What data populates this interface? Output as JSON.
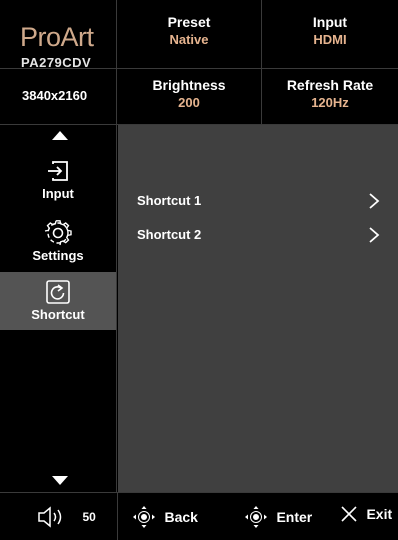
{
  "brand": {
    "logo": "ProArt",
    "model": "PA279CDV",
    "resolution": "3840x2160"
  },
  "status": {
    "preset": {
      "label": "Preset",
      "value": "Native"
    },
    "input": {
      "label": "Input",
      "value": "HDMI"
    },
    "brightness": {
      "label": "Brightness",
      "value": "200"
    },
    "refresh_rate": {
      "label": "Refresh Rate",
      "value": "120Hz"
    }
  },
  "sidebar": {
    "items": [
      {
        "label": "Input",
        "icon": "input-icon",
        "active": false
      },
      {
        "label": "Settings",
        "icon": "gear-icon",
        "active": false
      },
      {
        "label": "Shortcut",
        "icon": "shortcut-icon",
        "active": true
      }
    ]
  },
  "main": {
    "rows": [
      {
        "label": "Shortcut 1",
        "icon": "chevron-right-icon"
      },
      {
        "label": "Shortcut 2",
        "icon": "chevron-right-icon"
      }
    ]
  },
  "footer": {
    "volume": "50",
    "back": "Back",
    "enter": "Enter",
    "exit": "Exit"
  },
  "colors": {
    "accent": "#e6b48f",
    "logo": "#cfa98b",
    "panel": "#404040",
    "active_item": "#545454"
  }
}
